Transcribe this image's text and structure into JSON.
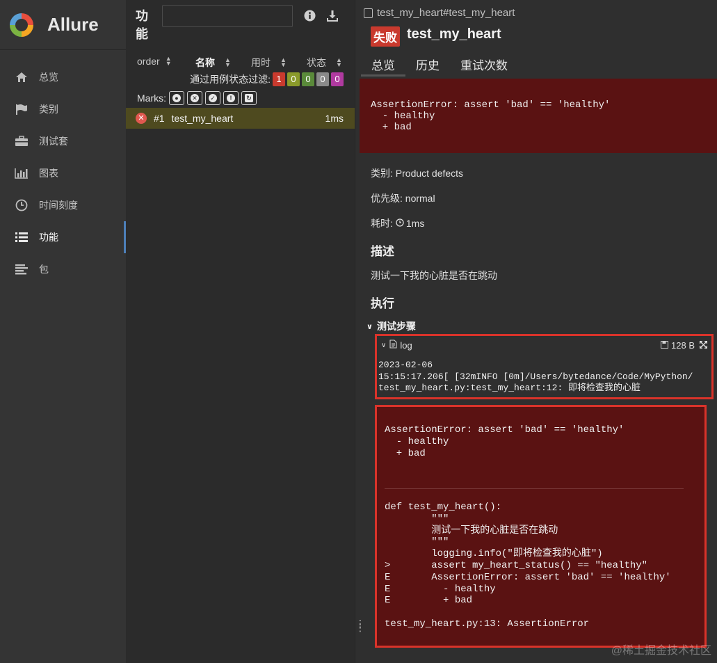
{
  "app": {
    "logo_text": "Allure"
  },
  "sidebar": {
    "items": [
      {
        "label": "总览",
        "icon": "home-icon"
      },
      {
        "label": "类别",
        "icon": "flag-icon"
      },
      {
        "label": "测试套",
        "icon": "briefcase-icon"
      },
      {
        "label": "图表",
        "icon": "bar-chart-icon"
      },
      {
        "label": "时间刻度",
        "icon": "clock-icon"
      },
      {
        "label": "功能",
        "icon": "list-icon",
        "active": true
      },
      {
        "label": "包",
        "icon": "align-left-icon"
      }
    ]
  },
  "tree": {
    "title": "功能",
    "search": {
      "value": "",
      "placeholder": ""
    },
    "columns": {
      "order": "order",
      "name": "名称",
      "duration": "用时",
      "status": "状态"
    },
    "filter_label": "通过用例状态过滤:",
    "filter_counts": [
      {
        "value": "1",
        "color": "#c93a2e"
      },
      {
        "value": "0",
        "color": "#8a9a2a"
      },
      {
        "value": "0",
        "color": "#5a8a3a"
      },
      {
        "value": "0",
        "color": "#8a8a8a"
      },
      {
        "value": "0",
        "color": "#b03aa0"
      }
    ],
    "marks_label": "Marks:",
    "rows": [
      {
        "order": "#1",
        "name": "test_my_heart",
        "duration": "1ms",
        "status": "failed"
      }
    ]
  },
  "detail": {
    "breadcrumb": "test_my_heart#test_my_heart",
    "status_label": "失败",
    "test_name": "test_my_heart",
    "tabs": [
      "总览",
      "历史",
      "重试次数"
    ],
    "error_message": "AssertionError: assert 'bad' == 'healthy'\n  - healthy\n  + bad",
    "category_line": "类别: Product defects",
    "severity_line": "优先级: normal",
    "duration_label": "耗时:",
    "duration_value": "1ms",
    "description_title": "描述",
    "description_text": "测试一下我的心脏是否在跳动",
    "execution_title": "执行",
    "steps_title": "测试步骤",
    "log": {
      "name": "log",
      "size": "128 B",
      "content": "2023-02-06\n15:15:17.206[ [32mINFO [0m]/Users/bytedance/Code/MyPython/\ntest_my_heart.py:test_my_heart:12: 即将检查我的心脏"
    },
    "trace_message": "AssertionError: assert 'bad' == 'healthy'\n  - healthy\n  + bad",
    "trace_code": "def test_my_heart():\n        \"\"\"\n        测试一下我的心脏是否在跳动\n        \"\"\"\n        logging.info(\"即将检查我的心脏\")\n>       assert my_heart_status() == \"healthy\"\nE       AssertionError: assert 'bad' == 'healthy'\nE         - healthy\nE         + bad\n\ntest_my_heart.py:13: AssertionError"
  },
  "watermark": "@稀土掘金技术社区"
}
